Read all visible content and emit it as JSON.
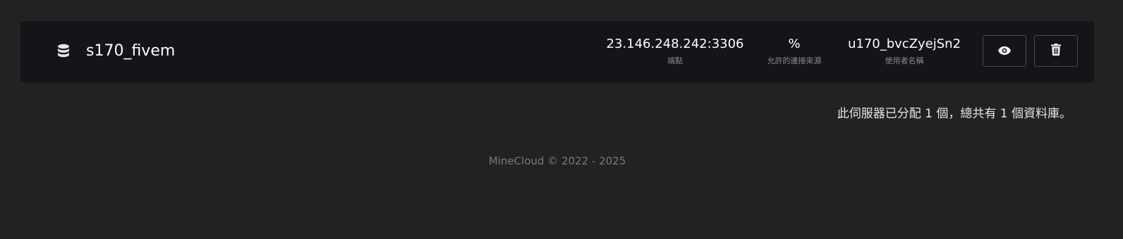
{
  "database": {
    "icon": "database-icon",
    "name": "s170_fivem",
    "endpoint": {
      "value": "23.146.248.242:3306",
      "label": "端點"
    },
    "allowed_connections": {
      "value": "%",
      "label": "允許的連接來源"
    },
    "username": {
      "value": "u170_bvcZyejSn2",
      "label": "使用者名稱"
    },
    "actions": {
      "view_icon": "eye-icon",
      "delete_icon": "trash-icon"
    }
  },
  "summary": "此伺服器已分配 1 個，總共有 1 個資料庫。",
  "footer": "MineCloud © 2022 - 2025"
}
